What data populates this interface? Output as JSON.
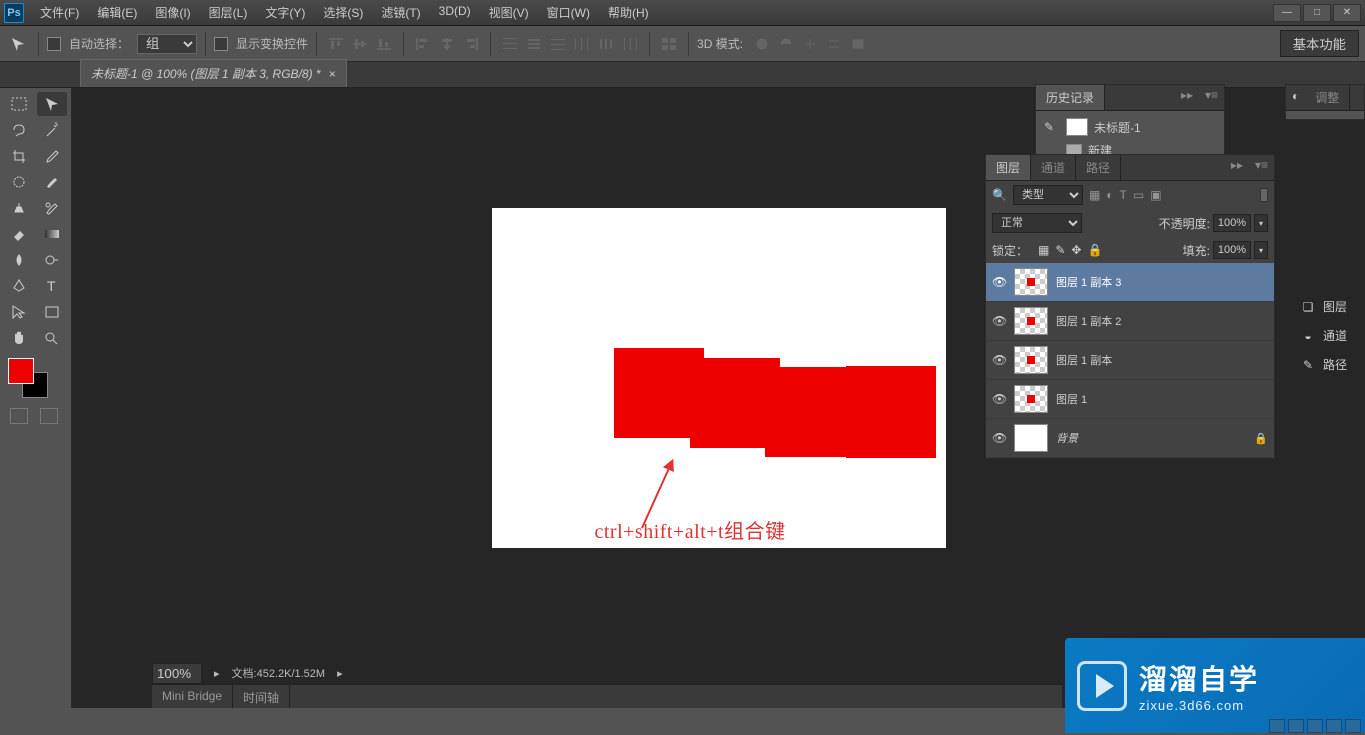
{
  "app": {
    "logo": "Ps"
  },
  "menu": [
    "文件(F)",
    "编辑(E)",
    "图像(I)",
    "图层(L)",
    "文字(Y)",
    "选择(S)",
    "滤镜(T)",
    "3D(D)",
    "视图(V)",
    "窗口(W)",
    "帮助(H)"
  ],
  "options": {
    "auto_select": "自动选择：",
    "group": "组",
    "show_transform": "显示变换控件",
    "mode_3d": "3D 模式:",
    "workspace": "基本功能"
  },
  "doc_tab": "未标题-1 @ 100% (图层 1 副本 3, RGB/8) *",
  "canvas_caption": "ctrl+shift+alt+t组合键",
  "status": {
    "zoom": "100%",
    "doc": "文档:452.2K/1.52M"
  },
  "bottom_tabs": [
    "Mini Bridge",
    "时间轴"
  ],
  "panels": {
    "history": {
      "tab": "历史记录",
      "doc": "未标题-1",
      "step": "新建"
    },
    "adjust": {
      "tab": "调整"
    },
    "layers": {
      "tabs": [
        "图层",
        "通道",
        "路径"
      ],
      "kind_label": "类型",
      "blend_mode": "正常",
      "opacity_label": "不透明度:",
      "opacity_val": "100%",
      "lock_label": "锁定：",
      "fill_label": "填充:",
      "fill_val": "100%",
      "items": [
        {
          "name": "图层 1 副本 3",
          "sel": true,
          "red": true
        },
        {
          "name": "图层 1 副本 2",
          "sel": false,
          "red": true
        },
        {
          "name": "图层 1 副本",
          "sel": false,
          "red": true
        },
        {
          "name": "图层 1",
          "sel": false,
          "red": true
        },
        {
          "name": "背景",
          "sel": false,
          "red": false,
          "lock": true,
          "italic": true
        }
      ]
    },
    "dock": [
      "图层",
      "通道",
      "路径"
    ]
  },
  "watermark": {
    "text": "溜溜自学",
    "url": "zixue.3d66.com"
  }
}
